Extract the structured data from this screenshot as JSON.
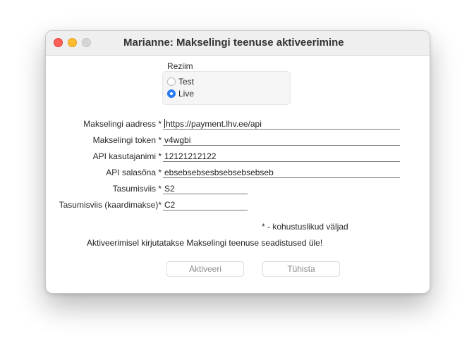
{
  "window": {
    "title": "Marianne: Makselingi teenuse aktiveerimine"
  },
  "mode": {
    "label": "Reziim",
    "options": [
      {
        "label": "Test",
        "selected": false
      },
      {
        "label": "Live",
        "selected": true
      }
    ]
  },
  "form": {
    "fields": [
      {
        "label": "Makselingi aadress *",
        "value": "https://payment.lhv.ee/api"
      },
      {
        "label": "Makselingi token *",
        "value": "v4wgbi"
      },
      {
        "label": "API kasutajanimi *",
        "value": "12121212122"
      },
      {
        "label": "API salasõna *",
        "value": "ebsebsebsesbsebsebsebseb"
      },
      {
        "label": "Tasumisviis *",
        "value": "S2"
      },
      {
        "label": "Tasumisviis (kaardimakse)*",
        "value": "C2"
      }
    ]
  },
  "required_note": "* - kohustuslikud väljad",
  "warning": "Aktiveerimisel kirjutatakse Makselingi teenuse seadistused üle!",
  "buttons": {
    "activate": "Aktiveeri",
    "cancel": "Tühista"
  },
  "colors": {
    "accent": "#2a7bf5",
    "close": "#fe5f57",
    "minimize": "#febc2e",
    "zoom_disabled": "#d6d6d6"
  }
}
